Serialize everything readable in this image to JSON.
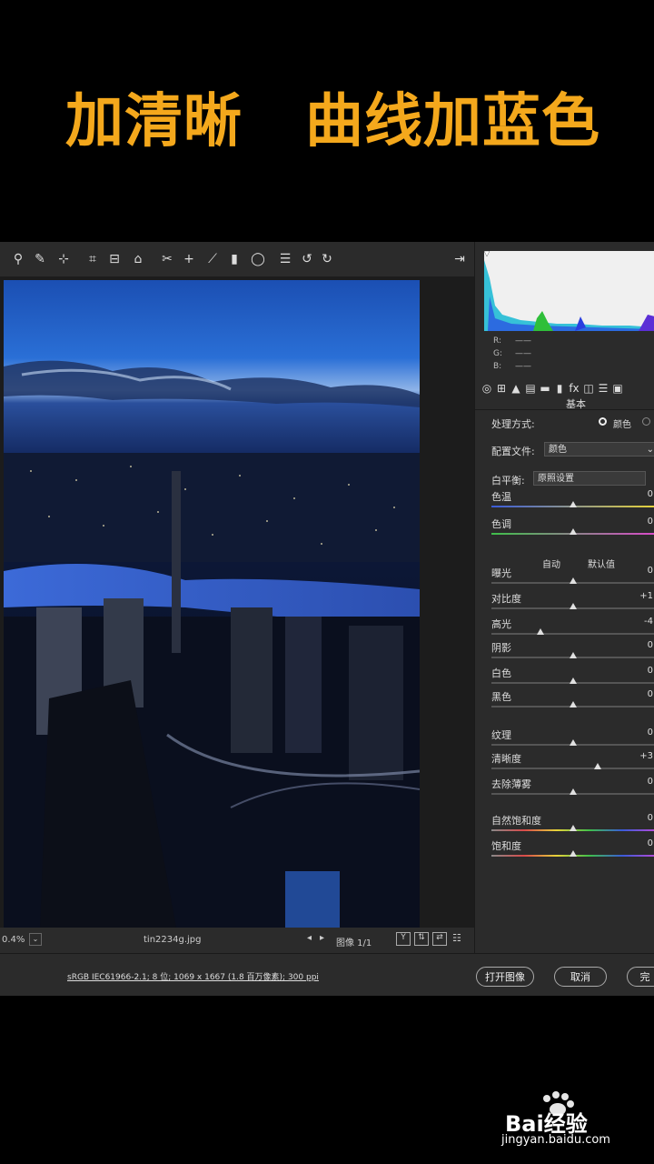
{
  "caption": {
    "left": "加清晰",
    "right": "曲线加蓝色"
  },
  "histogram": {
    "r": "R:",
    "g": "G:",
    "b": "B:",
    "dash": "——"
  },
  "panel": {
    "section": "基本",
    "process_label": "处理方式:",
    "process_value": "颜色",
    "profile_label": "配置文件:",
    "profile_value": "颜色",
    "wb_label": "白平衡:",
    "wb_value": "原照设置",
    "auto": "自动",
    "default": "默认值",
    "sliders": [
      {
        "label": "色温",
        "value": "0",
        "pos": 0.5
      },
      {
        "label": "色调",
        "value": "0",
        "pos": 0.5
      },
      {
        "label": "曝光",
        "value": "0",
        "pos": 0.5
      },
      {
        "label": "对比度",
        "value": "+1",
        "pos": 0.5
      },
      {
        "label": "高光",
        "value": "-4",
        "pos": 0.3
      },
      {
        "label": "阴影",
        "value": "0",
        "pos": 0.5
      },
      {
        "label": "白色",
        "value": "0",
        "pos": 0.5
      },
      {
        "label": "黑色",
        "value": "0",
        "pos": 0.5
      },
      {
        "label": "纹理",
        "value": "0",
        "pos": 0.5
      },
      {
        "label": "清晰度",
        "value": "+3",
        "pos": 0.65
      },
      {
        "label": "去除薄雾",
        "value": "0",
        "pos": 0.5
      },
      {
        "label": "自然饱和度",
        "value": "0",
        "pos": 0.5
      },
      {
        "label": "饱和度",
        "value": "0",
        "pos": 0.5
      }
    ]
  },
  "status": {
    "zoom": "0.4%",
    "filename": "tin2234g.jpg",
    "image_count": "图像 1/1"
  },
  "footer": {
    "info": "sRGB IEC61966-2.1; 8 位; 1069 x 1667 (1.8 百万像素); 300 ppi",
    "open": "打开图像",
    "cancel": "取消",
    "done": "完"
  },
  "watermark": {
    "brand": "Bai经验",
    "url": "jingyan.baidu.com"
  },
  "colors": {
    "accent": "#f4a81c",
    "panel_bg": "#2b2b2b"
  }
}
